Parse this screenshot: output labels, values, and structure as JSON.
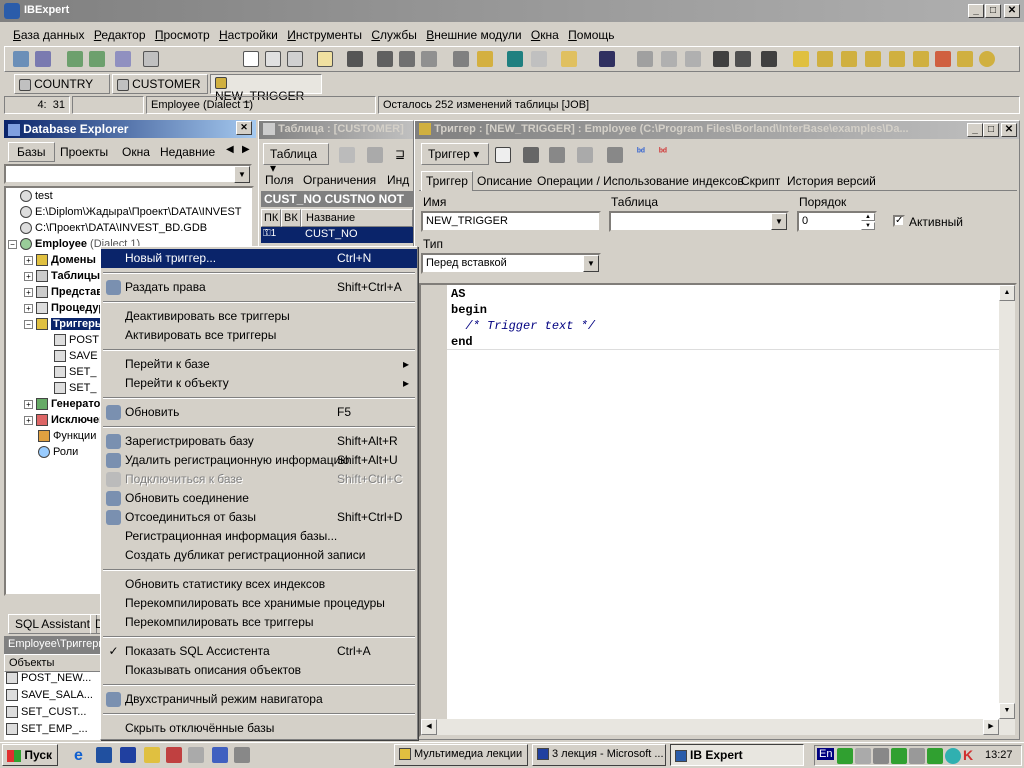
{
  "app": {
    "title": "IBExpert"
  },
  "menu": [
    "База данных",
    "Редактор",
    "Просмотр",
    "Настройки",
    "Инструменты",
    "Службы",
    "Внешние модули",
    "Окна",
    "Помощь"
  ],
  "window_tabs": [
    "COUNTRY",
    "CUSTOMER",
    "NEW_TRIGGER"
  ],
  "status": {
    "pos": "4:",
    "col": "31",
    "db": "Employee (Dialect 1)",
    "info": "Осталось 252 изменений таблицы [JOB]"
  },
  "explorer": {
    "title": "Database Explorer",
    "tabs": [
      "Базы",
      "Проекты",
      "Окна",
      "Недавние"
    ],
    "tree": [
      {
        "label": "test"
      },
      {
        "label": "E:\\Diplom\\Жадыра\\Проект\\DATA\\INVEST"
      },
      {
        "label": "C:\\Проект\\DATA\\INVEST_BD.GDB"
      },
      {
        "label": "Employee",
        "extra": "(Dialect 1)"
      },
      {
        "label": "Домены"
      },
      {
        "label": "Таблицы"
      },
      {
        "label": "Представления"
      },
      {
        "label": "Процедуры"
      },
      {
        "label": "Триггеры"
      },
      {
        "label": "POST"
      },
      {
        "label": "SAVE"
      },
      {
        "label": "SET_"
      },
      {
        "label": "SET_"
      },
      {
        "label": "Генераторы"
      },
      {
        "label": "Исключения"
      },
      {
        "label": "Функции"
      },
      {
        "label": "Роли"
      }
    ],
    "sql_tabs": [
      "SQL Assistant",
      "D"
    ],
    "breadcrumb": "Employee\\Триггеры",
    "objects_header": "Объекты",
    "objects": [
      "POST_NEW...",
      "SAVE_SALA...",
      "SET_CUST...",
      "SET_EMP_..."
    ]
  },
  "table_window": {
    "title": "Таблица : [CUSTOMER]",
    "menu_label": "Таблица",
    "tabs": [
      "Поля",
      "Ограничения",
      "Инд"
    ],
    "field_header": "CUST_NO CUSTNO NOT",
    "columns": [
      "ПК",
      "ВК",
      "Название"
    ],
    "row": "CUST_NO"
  },
  "trigger_window": {
    "title": "Триггер : [NEW_TRIGGER] : Employee (C:\\Program Files\\Borland\\InterBase\\examples\\Da...",
    "menu_label": "Триггер",
    "tabs": [
      "Триггер",
      "Описание",
      "Операции / Использование индексов",
      "Скрипт",
      "История версий"
    ],
    "labels": {
      "name": "Имя",
      "table": "Таблица",
      "order": "Порядок",
      "active": "Активный",
      "type": "Тип"
    },
    "name_value": "NEW_TRIGGER",
    "order_value": "0",
    "type_value": "Перед вставкой",
    "code": [
      "AS",
      "begin",
      "  /* Trigger text */",
      "end"
    ]
  },
  "context_menu": [
    {
      "label": "Новый триггер...",
      "shortcut": "Ctrl+N",
      "highlight": true
    },
    {
      "sep": true
    },
    {
      "label": "Раздать права",
      "shortcut": "Shift+Ctrl+A",
      "icon": "key-icon"
    },
    {
      "sep": true
    },
    {
      "label": "Деактивировать все триггеры"
    },
    {
      "label": "Активировать все триггеры"
    },
    {
      "sep": true
    },
    {
      "label": "Перейти к базе",
      "submenu": true
    },
    {
      "label": "Перейти к объекту",
      "submenu": true
    },
    {
      "sep": true
    },
    {
      "label": "Обновить",
      "shortcut": "F5",
      "icon": "refresh-icon"
    },
    {
      "sep": true
    },
    {
      "label": "Зарегистрировать базу",
      "shortcut": "Shift+Alt+R",
      "icon": "register-db-icon"
    },
    {
      "label": "Удалить регистрационную информацию",
      "shortcut": "Shift+Alt+U",
      "icon": "unregister-db-icon"
    },
    {
      "label": "Подключиться к базе",
      "shortcut": "Shift+Ctrl+C",
      "disabled": true,
      "icon": "connect-icon"
    },
    {
      "label": "Обновить соединение",
      "icon": "reconnect-icon"
    },
    {
      "label": "Отсоединиться от базы",
      "shortcut": "Shift+Ctrl+D",
      "icon": "disconnect-icon"
    },
    {
      "label": "Регистрационная информация базы..."
    },
    {
      "label": "Создать дубликат регистрационной записи"
    },
    {
      "sep": true
    },
    {
      "label": "Обновить статистику всех индексов"
    },
    {
      "label": "Перекомпилировать все хранимые процедуры"
    },
    {
      "label": "Перекомпилировать все триггеры"
    },
    {
      "sep": true
    },
    {
      "label": "Показать SQL Ассистента",
      "shortcut": "Ctrl+A",
      "checked": true
    },
    {
      "label": "Показывать описания объектов"
    },
    {
      "sep": true
    },
    {
      "label": "Двухстраничный режим навигатора",
      "icon": "two-page-icon"
    },
    {
      "sep": true
    },
    {
      "label": "Скрыть отключённые базы"
    }
  ],
  "taskbar": {
    "start": "Пуск",
    "tasks": [
      "Мультимедиа лекции",
      "3 лекция - Microsoft ...",
      "IB Expert"
    ],
    "lang": "En",
    "clock": "13:27"
  }
}
